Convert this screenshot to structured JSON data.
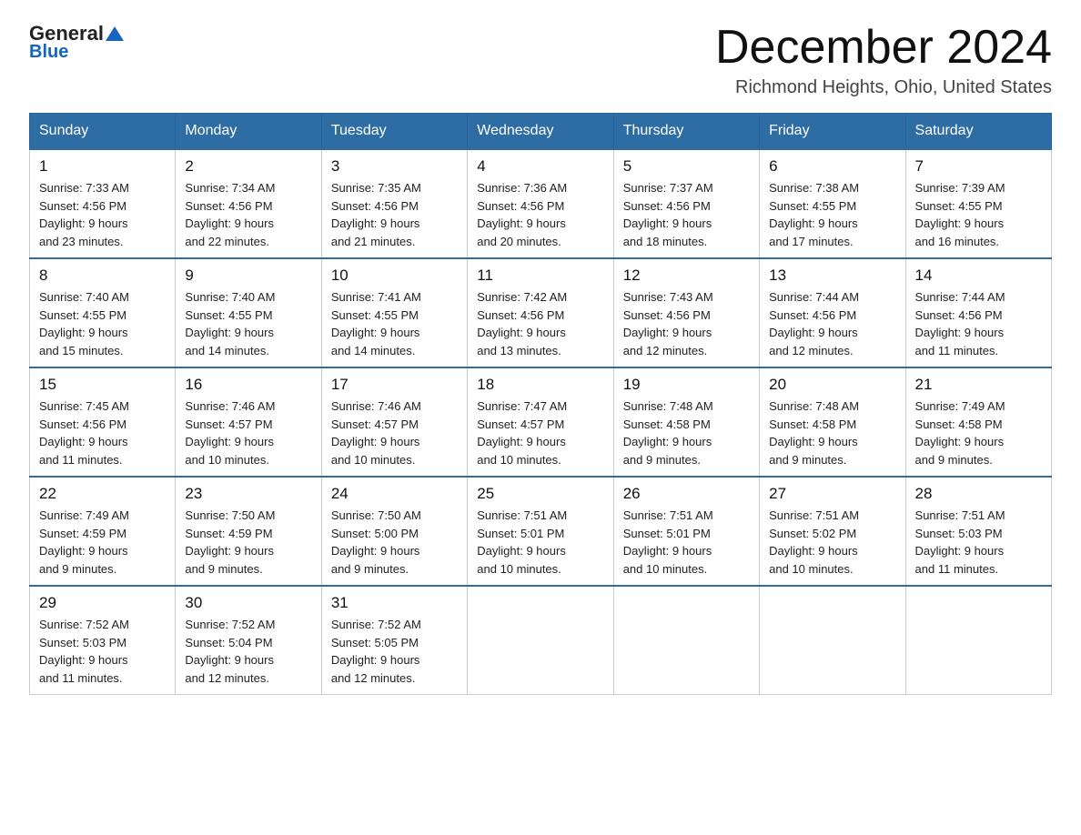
{
  "header": {
    "logo_general": "General",
    "logo_blue": "Blue",
    "month": "December 2024",
    "location": "Richmond Heights, Ohio, United States"
  },
  "days_of_week": [
    "Sunday",
    "Monday",
    "Tuesday",
    "Wednesday",
    "Thursday",
    "Friday",
    "Saturday"
  ],
  "weeks": [
    [
      {
        "day": "1",
        "sunrise": "7:33 AM",
        "sunset": "4:56 PM",
        "daylight": "9 hours and 23 minutes."
      },
      {
        "day": "2",
        "sunrise": "7:34 AM",
        "sunset": "4:56 PM",
        "daylight": "9 hours and 22 minutes."
      },
      {
        "day": "3",
        "sunrise": "7:35 AM",
        "sunset": "4:56 PM",
        "daylight": "9 hours and 21 minutes."
      },
      {
        "day": "4",
        "sunrise": "7:36 AM",
        "sunset": "4:56 PM",
        "daylight": "9 hours and 20 minutes."
      },
      {
        "day": "5",
        "sunrise": "7:37 AM",
        "sunset": "4:56 PM",
        "daylight": "9 hours and 18 minutes."
      },
      {
        "day": "6",
        "sunrise": "7:38 AM",
        "sunset": "4:55 PM",
        "daylight": "9 hours and 17 minutes."
      },
      {
        "day": "7",
        "sunrise": "7:39 AM",
        "sunset": "4:55 PM",
        "daylight": "9 hours and 16 minutes."
      }
    ],
    [
      {
        "day": "8",
        "sunrise": "7:40 AM",
        "sunset": "4:55 PM",
        "daylight": "9 hours and 15 minutes."
      },
      {
        "day": "9",
        "sunrise": "7:40 AM",
        "sunset": "4:55 PM",
        "daylight": "9 hours and 14 minutes."
      },
      {
        "day": "10",
        "sunrise": "7:41 AM",
        "sunset": "4:55 PM",
        "daylight": "9 hours and 14 minutes."
      },
      {
        "day": "11",
        "sunrise": "7:42 AM",
        "sunset": "4:56 PM",
        "daylight": "9 hours and 13 minutes."
      },
      {
        "day": "12",
        "sunrise": "7:43 AM",
        "sunset": "4:56 PM",
        "daylight": "9 hours and 12 minutes."
      },
      {
        "day": "13",
        "sunrise": "7:44 AM",
        "sunset": "4:56 PM",
        "daylight": "9 hours and 12 minutes."
      },
      {
        "day": "14",
        "sunrise": "7:44 AM",
        "sunset": "4:56 PM",
        "daylight": "9 hours and 11 minutes."
      }
    ],
    [
      {
        "day": "15",
        "sunrise": "7:45 AM",
        "sunset": "4:56 PM",
        "daylight": "9 hours and 11 minutes."
      },
      {
        "day": "16",
        "sunrise": "7:46 AM",
        "sunset": "4:57 PM",
        "daylight": "9 hours and 10 minutes."
      },
      {
        "day": "17",
        "sunrise": "7:46 AM",
        "sunset": "4:57 PM",
        "daylight": "9 hours and 10 minutes."
      },
      {
        "day": "18",
        "sunrise": "7:47 AM",
        "sunset": "4:57 PM",
        "daylight": "9 hours and 10 minutes."
      },
      {
        "day": "19",
        "sunrise": "7:48 AM",
        "sunset": "4:58 PM",
        "daylight": "9 hours and 9 minutes."
      },
      {
        "day": "20",
        "sunrise": "7:48 AM",
        "sunset": "4:58 PM",
        "daylight": "9 hours and 9 minutes."
      },
      {
        "day": "21",
        "sunrise": "7:49 AM",
        "sunset": "4:58 PM",
        "daylight": "9 hours and 9 minutes."
      }
    ],
    [
      {
        "day": "22",
        "sunrise": "7:49 AM",
        "sunset": "4:59 PM",
        "daylight": "9 hours and 9 minutes."
      },
      {
        "day": "23",
        "sunrise": "7:50 AM",
        "sunset": "4:59 PM",
        "daylight": "9 hours and 9 minutes."
      },
      {
        "day": "24",
        "sunrise": "7:50 AM",
        "sunset": "5:00 PM",
        "daylight": "9 hours and 9 minutes."
      },
      {
        "day": "25",
        "sunrise": "7:51 AM",
        "sunset": "5:01 PM",
        "daylight": "9 hours and 10 minutes."
      },
      {
        "day": "26",
        "sunrise": "7:51 AM",
        "sunset": "5:01 PM",
        "daylight": "9 hours and 10 minutes."
      },
      {
        "day": "27",
        "sunrise": "7:51 AM",
        "sunset": "5:02 PM",
        "daylight": "9 hours and 10 minutes."
      },
      {
        "day": "28",
        "sunrise": "7:51 AM",
        "sunset": "5:03 PM",
        "daylight": "9 hours and 11 minutes."
      }
    ],
    [
      {
        "day": "29",
        "sunrise": "7:52 AM",
        "sunset": "5:03 PM",
        "daylight": "9 hours and 11 minutes."
      },
      {
        "day": "30",
        "sunrise": "7:52 AM",
        "sunset": "5:04 PM",
        "daylight": "9 hours and 12 minutes."
      },
      {
        "day": "31",
        "sunrise": "7:52 AM",
        "sunset": "5:05 PM",
        "daylight": "9 hours and 12 minutes."
      },
      null,
      null,
      null,
      null
    ]
  ],
  "labels": {
    "sunrise": "Sunrise:",
    "sunset": "Sunset:",
    "daylight": "Daylight:"
  }
}
